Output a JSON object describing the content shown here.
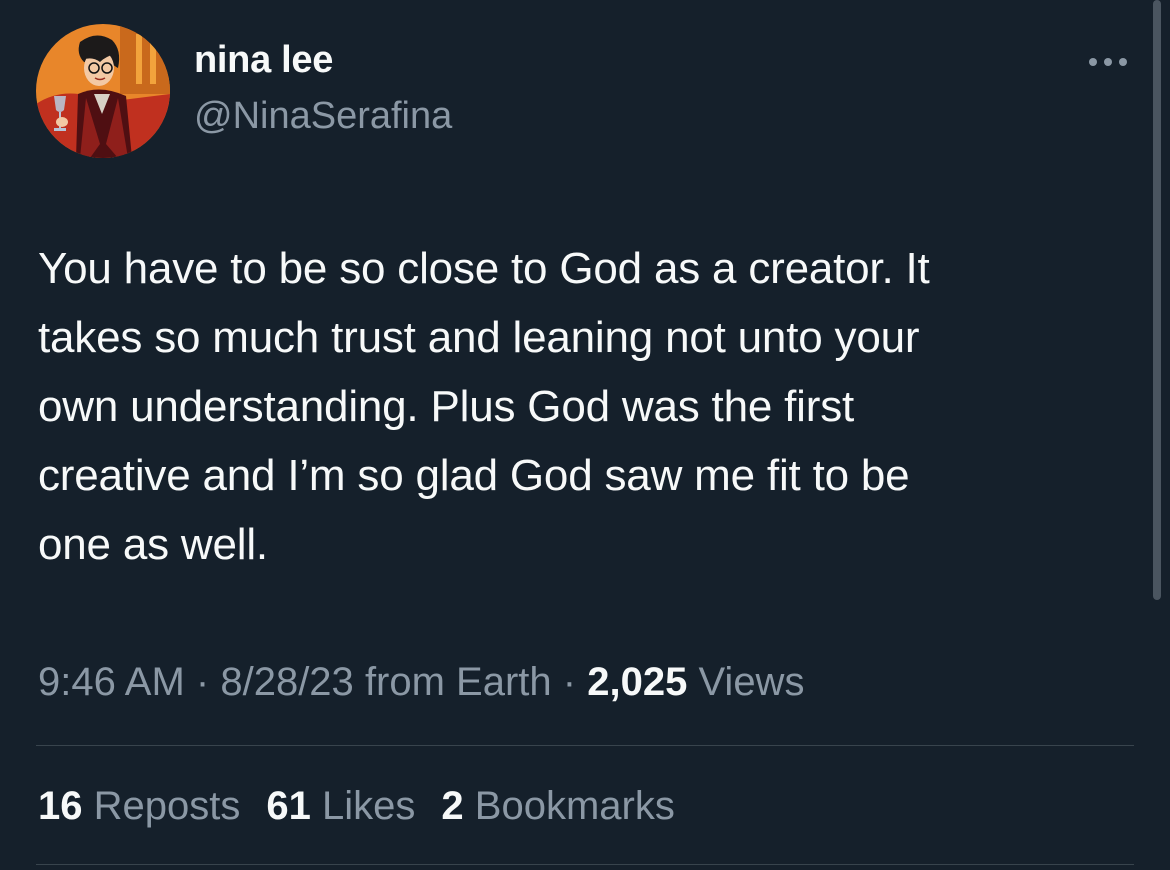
{
  "author": {
    "display_name": "nina lee",
    "handle": "@NinaSerafina",
    "avatar_icon": "cartoon-character-avatar"
  },
  "tweet": {
    "text": "You have to be so close to God as a creator. It\ntakes so much trust and leaning not unto your\nown understanding. Plus God was the first\ncreative and I’m so glad God saw me fit to be\none as well."
  },
  "meta": {
    "time": "9:46 AM",
    "separator": "·",
    "date": "8/28/23",
    "source": "from Earth",
    "views_count": "2,025",
    "views_label": "Views"
  },
  "stats": {
    "reposts_count": "16",
    "reposts_label": "Reposts",
    "likes_count": "61",
    "likes_label": "Likes",
    "bookmarks_count": "2",
    "bookmarks_label": "Bookmarks"
  },
  "icons": {
    "more": "more-horizontal-icon"
  },
  "colors": {
    "background": "#15202b",
    "primary_text": "#f7f9f9",
    "secondary_text": "#8b98a5",
    "divider": "#38444d"
  }
}
